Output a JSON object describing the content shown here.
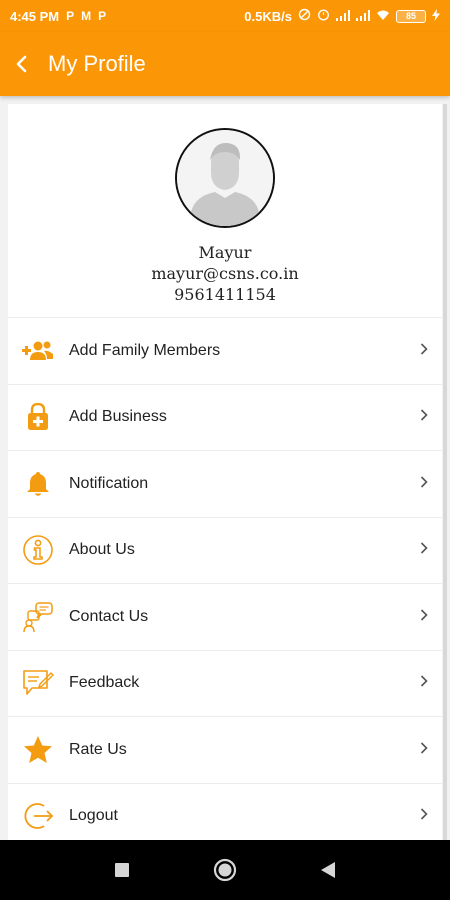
{
  "status_bar": {
    "time": "4:45 PM",
    "left_icons": [
      "P",
      "M",
      "P"
    ],
    "net_speed": "0.5KB/s",
    "battery": "85"
  },
  "app_bar": {
    "back_icon": "chevron-left-icon",
    "title": "My Profile",
    "background": "#fb9706"
  },
  "profile": {
    "name": "Mayur",
    "email": "mayur@csns.co.in",
    "phone": "9561411154"
  },
  "menu": [
    {
      "label": "Add Family Members",
      "icon": "add-family-icon"
    },
    {
      "label": "Add Business",
      "icon": "add-business-icon"
    },
    {
      "label": "Notification",
      "icon": "bell-icon"
    },
    {
      "label": "About Us",
      "icon": "info-icon"
    },
    {
      "label": "Contact Us",
      "icon": "contact-icon"
    },
    {
      "label": "Feedback",
      "icon": "feedback-icon"
    },
    {
      "label": "Rate Us",
      "icon": "star-icon"
    },
    {
      "label": "Logout",
      "icon": "logout-icon"
    }
  ],
  "accent_color": "#f39c12"
}
